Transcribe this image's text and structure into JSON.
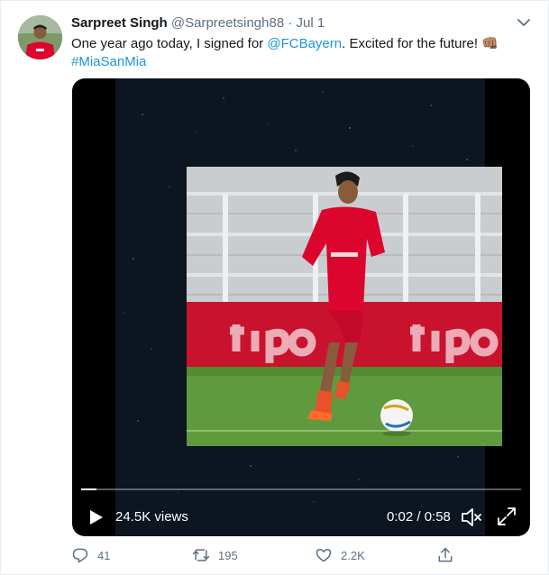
{
  "tweet": {
    "name": "Sarpreet Singh",
    "handle": "@Sarpreetsingh88",
    "date": "· Jul 1",
    "text_prefix": "One year ago today, I signed for ",
    "mention": "@FCBayern",
    "text_suffix": ". Excited for the future! 👊🏽",
    "hashtag": "#MiaSanMia"
  },
  "video": {
    "views": "24.5K views",
    "time": "0:02 / 0:58",
    "progress": 0.034
  },
  "actions": {
    "replies": "41",
    "retweets": "195",
    "likes": "2.2K"
  },
  "colors": {
    "link": "#1b95e0",
    "muted": "#5b7083",
    "jersey": "#dc052d"
  }
}
